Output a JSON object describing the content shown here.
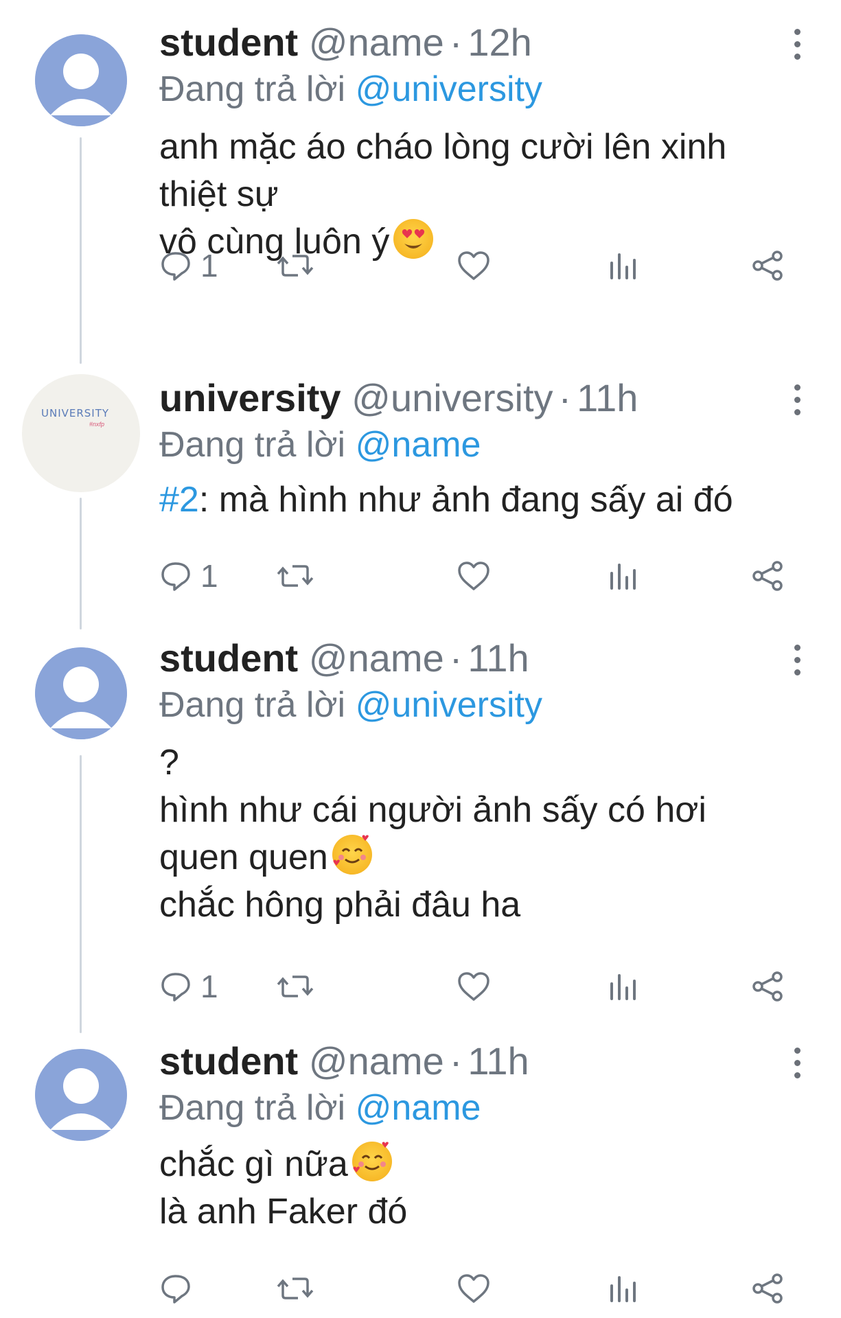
{
  "colors": {
    "accent": "#2c98e0",
    "muted": "#6e7680",
    "text": "#222222",
    "avatar_default": "#8aa4d9",
    "connector": "#cfd6de"
  },
  "reply_prefix": "Đang trả lời",
  "tweets": [
    {
      "display_name": "student",
      "handle": "@name",
      "separator": "·",
      "time": "12h",
      "reply_to": "@university",
      "avatar_icon": "default-avatar-icon",
      "body_lines": [
        "anh mặc áo cháo lòng cười lên xinh",
        "thiệt sự",
        "vô cùng luôn ý"
      ],
      "emoji": "heart-eyes-emoji",
      "reply_count": "1"
    },
    {
      "display_name": "university",
      "handle": "@university",
      "separator": "·",
      "time": "11h",
      "reply_to": "@name",
      "avatar_logo_text": "UNIVERSITY",
      "avatar_logo_sub": "#nxfp",
      "hashtag": "#2",
      "body_rest": ": mà hình như ảnh đang sấy ai đó",
      "reply_count": "1"
    },
    {
      "display_name": "student",
      "handle": "@name",
      "separator": "·",
      "time": "11h",
      "reply_to": "@university",
      "avatar_icon": "default-avatar-icon",
      "body_lines": [
        "?",
        "hình như cái người ảnh sấy có hơi",
        "quen quen",
        "chắc hông phải đâu ha"
      ],
      "emoji": "smiling-face-with-hearts-emoji",
      "reply_count": "1"
    },
    {
      "display_name": "student",
      "handle": "@name",
      "separator": "·",
      "time": "11h",
      "reply_to": "@name",
      "avatar_icon": "default-avatar-icon",
      "body_lines": [
        "chắc gì nữa",
        "là anh Faker đó"
      ],
      "emoji": "smiling-face-with-hearts-emoji",
      "reply_count": ""
    }
  ]
}
